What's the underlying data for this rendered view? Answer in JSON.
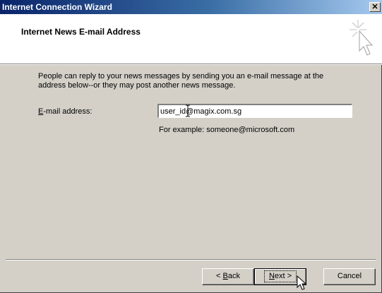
{
  "window": {
    "title": "Internet Connection Wizard",
    "close_glyph": "✕"
  },
  "header": {
    "heading": "Internet News E-mail Address",
    "graphic_icon": "wizard-sparkle-cursor-icon"
  },
  "body": {
    "intro": "People can reply to your news messages by sending you an e-mail message at the address below--or they may post another news message.",
    "email_label_accel": "E",
    "email_label_rest": "-mail address:",
    "email_value": "user_id@magix.com.sg",
    "example": "For example: someone@microsoft.com"
  },
  "buttons": {
    "back_prefix": "< ",
    "back_accel": "B",
    "back_rest": "ack",
    "next_accel": "N",
    "next_rest": "ext >",
    "cancel": "Cancel"
  },
  "colors": {
    "title_start": "#0a246a",
    "title_end": "#a6caf0",
    "face": "#d4d0c8"
  }
}
